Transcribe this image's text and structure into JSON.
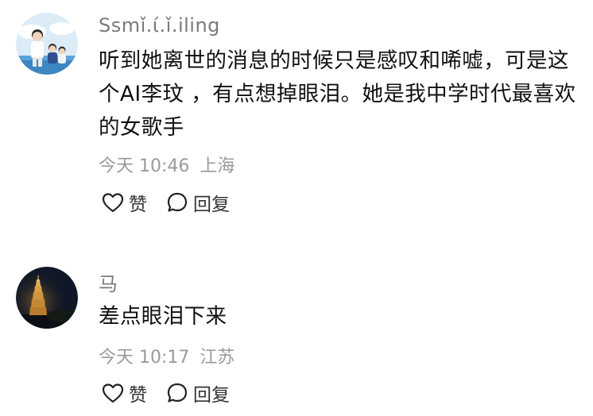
{
  "comments": [
    {
      "username": "Ssmǐ.ί.ǐ.iling",
      "text": "听到她离世的消息的时候只是感叹和唏嘘，可是这个AI李玟 ，有点想掉眼泪。她是我中学时代最喜欢的女歌手",
      "time": "今天 10:46",
      "location": "上海",
      "like_label": "赞",
      "reply_label": "回复"
    },
    {
      "username": "马",
      "text": "差点眼泪下来",
      "time": "今天 10:17",
      "location": "江苏",
      "like_label": "赞",
      "reply_label": "回复"
    }
  ],
  "colors": {
    "username": "#7a7a7a",
    "meta": "#9a9a9a",
    "text": "#111111"
  },
  "icons": {
    "like": "heart-icon",
    "reply": "speech-bubble-icon"
  }
}
